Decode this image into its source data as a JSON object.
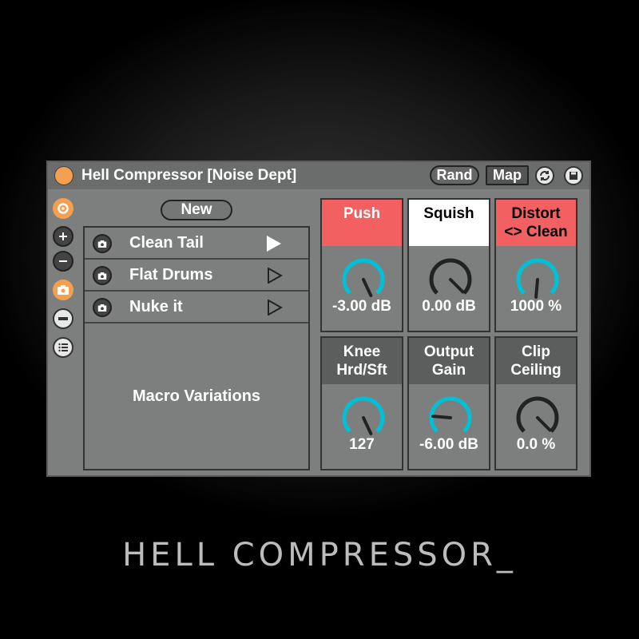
{
  "device": {
    "title": "Hell Compressor [Noise Dept]",
    "rand_label": "Rand",
    "map_label": "Map"
  },
  "variations": {
    "new_label": "New",
    "presets": [
      {
        "label": "Clean Tail",
        "active": true
      },
      {
        "label": "Flat Drums",
        "active": false
      },
      {
        "label": "Nuke it",
        "active": false
      }
    ],
    "macro_label": "Macro Variations"
  },
  "knobs": [
    {
      "title": "Push",
      "value": "-3.00 dB",
      "header_color": "#f36062",
      "header_text_color": "#ffffff",
      "arc_color": "#00c0d8",
      "angle": 145
    },
    {
      "title": "Squish",
      "value": "0.00 dB",
      "header_color": "#ffffff",
      "header_text_color": "#000000",
      "arc_color": "#222222",
      "angle": 135
    },
    {
      "title": "Distort\n<> Clean",
      "value": "1000 %",
      "header_color": "#f36062",
      "header_text_color": "#000000",
      "arc_color": "#00c0d8",
      "angle": 160
    },
    {
      "title": "Knee\nHrd/Sft",
      "value": "127",
      "header_color": "#5c5e5e",
      "header_text_color": "#ffffff",
      "arc_color": "#00c0d8",
      "angle": 145
    },
    {
      "title": "Output\nGain",
      "value": "-6.00 dB",
      "header_color": "#5c5e5e",
      "header_text_color": "#ffffff",
      "arc_color": "#00c0d8",
      "angle": 25
    },
    {
      "title": "Clip\nCeiling",
      "value": "0.0 %",
      "header_color": "#5c5e5e",
      "header_text_color": "#ffffff",
      "arc_color": "#222222",
      "angle": 135
    }
  ],
  "footer": {
    "title": "HELL COMPRESSOR_"
  },
  "colors": {
    "accent_orange": "#f3a150",
    "accent_cyan": "#00c0d8",
    "accent_red": "#f36062"
  }
}
